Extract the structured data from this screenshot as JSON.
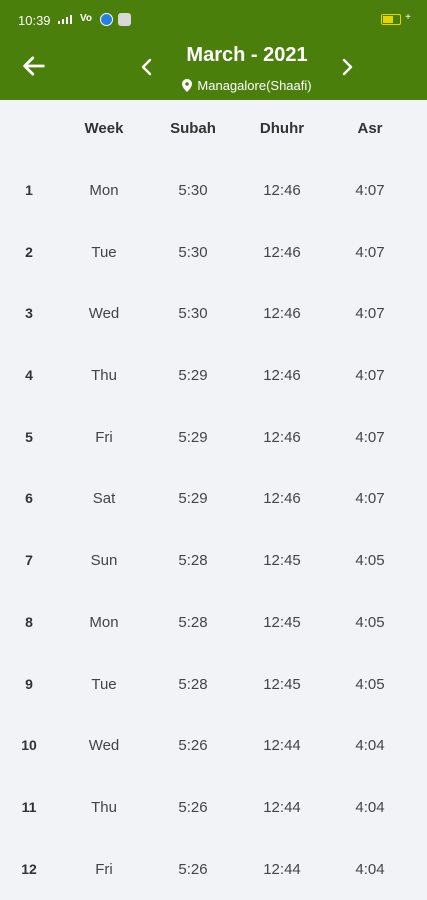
{
  "status": {
    "time": "10:39",
    "net": "Vo"
  },
  "header": {
    "title": "March - 2021",
    "location": "Managalore(Shaafi)"
  },
  "columns": [
    "",
    "Week",
    "Subah",
    "Dhuhr",
    "Asr"
  ],
  "rows": [
    {
      "day": "1",
      "week": "Mon",
      "subah": "5:30",
      "dhuhr": "12:46",
      "asr": "4:07"
    },
    {
      "day": "2",
      "week": "Tue",
      "subah": "5:30",
      "dhuhr": "12:46",
      "asr": "4:07"
    },
    {
      "day": "3",
      "week": "Wed",
      "subah": "5:30",
      "dhuhr": "12:46",
      "asr": "4:07"
    },
    {
      "day": "4",
      "week": "Thu",
      "subah": "5:29",
      "dhuhr": "12:46",
      "asr": "4:07"
    },
    {
      "day": "5",
      "week": "Fri",
      "subah": "5:29",
      "dhuhr": "12:46",
      "asr": "4:07"
    },
    {
      "day": "6",
      "week": "Sat",
      "subah": "5:29",
      "dhuhr": "12:46",
      "asr": "4:07"
    },
    {
      "day": "7",
      "week": "Sun",
      "subah": "5:28",
      "dhuhr": "12:45",
      "asr": "4:05"
    },
    {
      "day": "8",
      "week": "Mon",
      "subah": "5:28",
      "dhuhr": "12:45",
      "asr": "4:05"
    },
    {
      "day": "9",
      "week": "Tue",
      "subah": "5:28",
      "dhuhr": "12:45",
      "asr": "4:05"
    },
    {
      "day": "10",
      "week": "Wed",
      "subah": "5:26",
      "dhuhr": "12:44",
      "asr": "4:04"
    },
    {
      "day": "11",
      "week": "Thu",
      "subah": "5:26",
      "dhuhr": "12:44",
      "asr": "4:04"
    },
    {
      "day": "12",
      "week": "Fri",
      "subah": "5:26",
      "dhuhr": "12:44",
      "asr": "4:04"
    }
  ],
  "icons": {
    "back": "arrow-left-icon",
    "prev": "chevron-left-icon",
    "next": "chevron-right-icon",
    "location": "map-pin-icon"
  },
  "colors": {
    "app_bar": "#4a7f0c",
    "background": "#f2f3f7",
    "battery": "#e6d400"
  }
}
